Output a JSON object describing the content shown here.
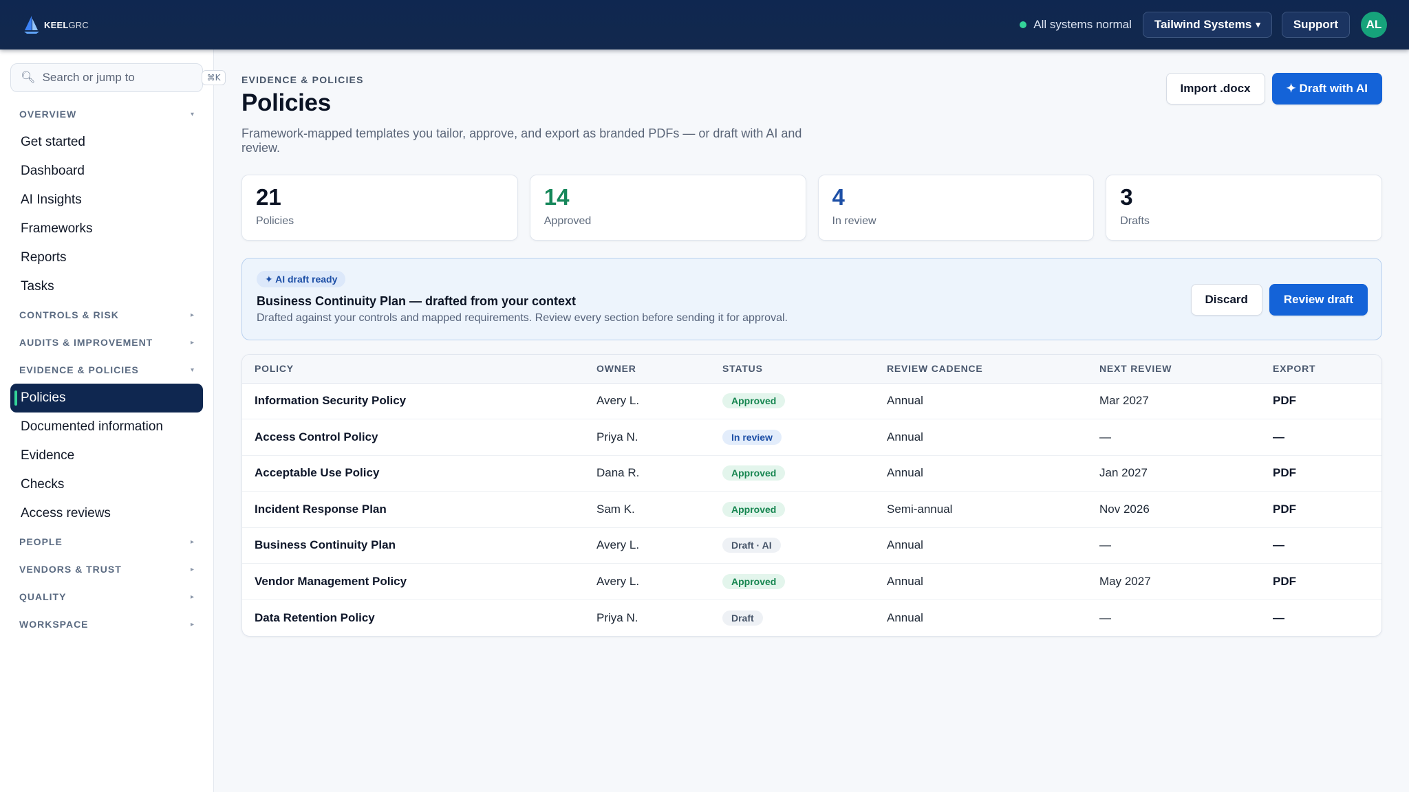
{
  "brand": {
    "name_bold": "KEEL",
    "name_light": "GRC"
  },
  "topbar": {
    "system_status": "All systems normal",
    "status_color": "#34d399",
    "org_selector": "Tailwind Systems",
    "org_caret": "▾",
    "support_label": "Support",
    "avatar_initials": "AL"
  },
  "sidebar": {
    "search": {
      "placeholder": "Search or jump to",
      "shortcut": "⌘K",
      "icon": "search-icon"
    },
    "overview_label": "OVERVIEW",
    "overview_items": [
      "Get started",
      "Dashboard",
      "AI Insights",
      "Frameworks",
      "Reports",
      "Tasks"
    ],
    "controls_label": "CONTROLS & RISK",
    "audits_label": "AUDITS & IMPROVEMENT",
    "evidence_label": "EVIDENCE & POLICIES",
    "evidence_items": [
      "Policies",
      "Documented information",
      "Evidence",
      "Checks",
      "Access reviews"
    ],
    "active_item": "Policies",
    "people_label": "PEOPLE",
    "vendors_label": "VENDORS & TRUST",
    "quality_label": "QUALITY",
    "workspace_label": "WORKSPACE",
    "collapsed_chevron": "▸",
    "expanded_chevron": "▾"
  },
  "page": {
    "eyebrow": "EVIDENCE & POLICIES",
    "title": "Policies",
    "description": "Framework-mapped templates you tailor, approve, and export as branded PDFs — or draft with AI and review.",
    "import_label": "Import .docx",
    "draft_ai_label": "✦ Draft with AI"
  },
  "stats": [
    {
      "value": "21",
      "label": "Policies",
      "color": "#0b1324"
    },
    {
      "value": "14",
      "label": "Approved",
      "color": "#16875a"
    },
    {
      "value": "4",
      "label": "In review",
      "color": "#1d4fa6"
    },
    {
      "value": "3",
      "label": "Drafts",
      "color": "#0b1324"
    }
  ],
  "banner": {
    "badge": "✦ AI draft ready",
    "title": "Business Continuity Plan — drafted from your context",
    "text": "Drafted against your controls and mapped requirements. Review every section before sending it for approval.",
    "discard_label": "Discard",
    "review_label": "Review draft"
  },
  "table": {
    "headers": [
      "POLICY",
      "OWNER",
      "STATUS",
      "REVIEW CADENCE",
      "NEXT REVIEW",
      "EXPORT"
    ],
    "rows": [
      {
        "policy": "Information Security Policy",
        "owner": "Avery L.",
        "status": "Approved",
        "status_kind": "approved",
        "cadence": "Annual",
        "next_review": "Mar 2027",
        "export": "PDF"
      },
      {
        "policy": "Access Control Policy",
        "owner": "Priya N.",
        "status": "In review",
        "status_kind": "review",
        "cadence": "Annual",
        "next_review": "—",
        "export": "—"
      },
      {
        "policy": "Acceptable Use Policy",
        "owner": "Dana R.",
        "status": "Approved",
        "status_kind": "approved",
        "cadence": "Annual",
        "next_review": "Jan 2027",
        "export": "PDF"
      },
      {
        "policy": "Incident Response Plan",
        "owner": "Sam K.",
        "status": "Approved",
        "status_kind": "approved",
        "cadence": "Semi-annual",
        "next_review": "Nov 2026",
        "export": "PDF"
      },
      {
        "policy": "Business Continuity Plan",
        "owner": "Avery L.",
        "status": "Draft · AI",
        "status_kind": "draft",
        "cadence": "Annual",
        "next_review": "—",
        "export": "—"
      },
      {
        "policy": "Vendor Management Policy",
        "owner": "Avery L.",
        "status": "Approved",
        "status_kind": "approved",
        "cadence": "Annual",
        "next_review": "May 2027",
        "export": "PDF"
      },
      {
        "policy": "Data Retention Policy",
        "owner": "Priya N.",
        "status": "Draft",
        "status_kind": "draft",
        "cadence": "Annual",
        "next_review": "—",
        "export": "—"
      }
    ]
  }
}
